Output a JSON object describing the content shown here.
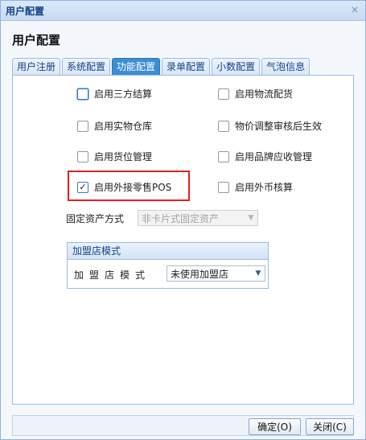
{
  "window": {
    "title": "用户配置",
    "heading": "用户配置",
    "close_glyph": "×"
  },
  "tabs": [
    {
      "label": "用户注册"
    },
    {
      "label": "系统配置"
    },
    {
      "label": "功能配置",
      "active": true
    },
    {
      "label": "录单配置"
    },
    {
      "label": "小数配置"
    },
    {
      "label": "气泡信息"
    }
  ],
  "options": {
    "third_party_settlement": {
      "label": "启用三方结算",
      "checked": false
    },
    "logistics_distribution": {
      "label": "启用物流配货",
      "checked": false
    },
    "physical_warehouse": {
      "label": "启用实物仓库",
      "checked": false
    },
    "price_adjust_audit": {
      "label": "物价调整审核后生效",
      "checked": false
    },
    "location_management": {
      "label": "启用货位管理",
      "checked": false
    },
    "brand_receivable": {
      "label": "启用品牌应收管理",
      "checked": false
    },
    "external_retail_pos": {
      "label": "启用外接零售POS",
      "checked": true
    },
    "foreign_currency": {
      "label": "启用外币核算",
      "checked": false
    }
  },
  "fixed_asset": {
    "label": "固定资产方式",
    "value": "非卡片式固定资产"
  },
  "franchise": {
    "legend": "加盟店模式",
    "label": "加盟店模式",
    "value": "未使用加盟店"
  },
  "buttons": {
    "ok": "确定(O)",
    "close": "关闭(C)"
  },
  "colors": {
    "accent": "#3c8ed3",
    "highlight": "#e02020",
    "border": "#99bbe8"
  }
}
